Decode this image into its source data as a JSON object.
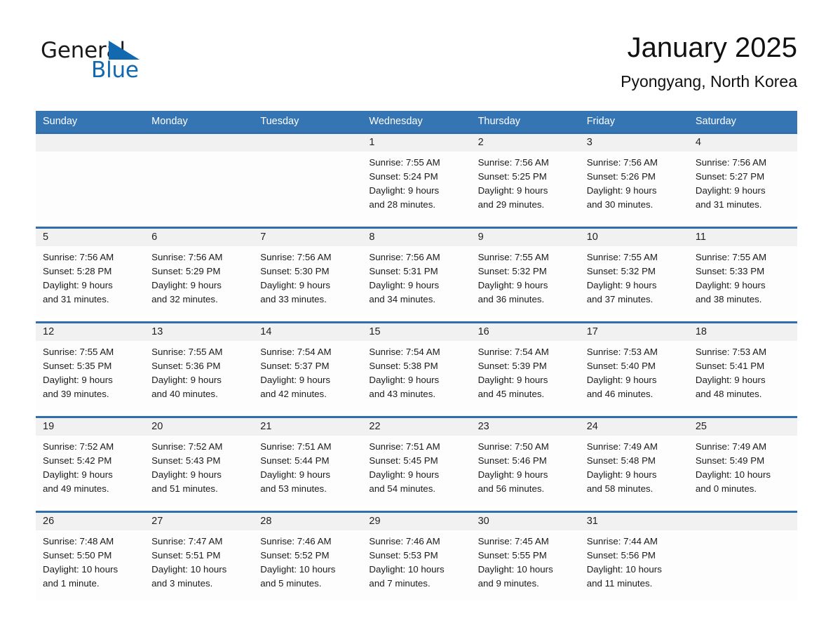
{
  "logo": {
    "word_one": "General",
    "word_two": "Blue",
    "flag_icon": "triangle-flag-icon",
    "brand_color": "#1369b0"
  },
  "header": {
    "title": "January 2025",
    "location": "Pyongyang, North Korea",
    "header_bg_color": "#3575b3",
    "row_divider_color": "#2f6fae",
    "daynum_bg_color": "#f1f1f1"
  },
  "weekdays": [
    "Sunday",
    "Monday",
    "Tuesday",
    "Wednesday",
    "Thursday",
    "Friday",
    "Saturday"
  ],
  "weeks": [
    {
      "days": [
        {
          "num": "",
          "sunrise": "",
          "sunset": "",
          "daylight_1": "",
          "daylight_2": ""
        },
        {
          "num": "",
          "sunrise": "",
          "sunset": "",
          "daylight_1": "",
          "daylight_2": ""
        },
        {
          "num": "",
          "sunrise": "",
          "sunset": "",
          "daylight_1": "",
          "daylight_2": ""
        },
        {
          "num": "1",
          "sunrise": "Sunrise: 7:55 AM",
          "sunset": "Sunset: 5:24 PM",
          "daylight_1": "Daylight: 9 hours",
          "daylight_2": "and 28 minutes."
        },
        {
          "num": "2",
          "sunrise": "Sunrise: 7:56 AM",
          "sunset": "Sunset: 5:25 PM",
          "daylight_1": "Daylight: 9 hours",
          "daylight_2": "and 29 minutes."
        },
        {
          "num": "3",
          "sunrise": "Sunrise: 7:56 AM",
          "sunset": "Sunset: 5:26 PM",
          "daylight_1": "Daylight: 9 hours",
          "daylight_2": "and 30 minutes."
        },
        {
          "num": "4",
          "sunrise": "Sunrise: 7:56 AM",
          "sunset": "Sunset: 5:27 PM",
          "daylight_1": "Daylight: 9 hours",
          "daylight_2": "and 31 minutes."
        }
      ]
    },
    {
      "days": [
        {
          "num": "5",
          "sunrise": "Sunrise: 7:56 AM",
          "sunset": "Sunset: 5:28 PM",
          "daylight_1": "Daylight: 9 hours",
          "daylight_2": "and 31 minutes."
        },
        {
          "num": "6",
          "sunrise": "Sunrise: 7:56 AM",
          "sunset": "Sunset: 5:29 PM",
          "daylight_1": "Daylight: 9 hours",
          "daylight_2": "and 32 minutes."
        },
        {
          "num": "7",
          "sunrise": "Sunrise: 7:56 AM",
          "sunset": "Sunset: 5:30 PM",
          "daylight_1": "Daylight: 9 hours",
          "daylight_2": "and 33 minutes."
        },
        {
          "num": "8",
          "sunrise": "Sunrise: 7:56 AM",
          "sunset": "Sunset: 5:31 PM",
          "daylight_1": "Daylight: 9 hours",
          "daylight_2": "and 34 minutes."
        },
        {
          "num": "9",
          "sunrise": "Sunrise: 7:55 AM",
          "sunset": "Sunset: 5:32 PM",
          "daylight_1": "Daylight: 9 hours",
          "daylight_2": "and 36 minutes."
        },
        {
          "num": "10",
          "sunrise": "Sunrise: 7:55 AM",
          "sunset": "Sunset: 5:32 PM",
          "daylight_1": "Daylight: 9 hours",
          "daylight_2": "and 37 minutes."
        },
        {
          "num": "11",
          "sunrise": "Sunrise: 7:55 AM",
          "sunset": "Sunset: 5:33 PM",
          "daylight_1": "Daylight: 9 hours",
          "daylight_2": "and 38 minutes."
        }
      ]
    },
    {
      "days": [
        {
          "num": "12",
          "sunrise": "Sunrise: 7:55 AM",
          "sunset": "Sunset: 5:35 PM",
          "daylight_1": "Daylight: 9 hours",
          "daylight_2": "and 39 minutes."
        },
        {
          "num": "13",
          "sunrise": "Sunrise: 7:55 AM",
          "sunset": "Sunset: 5:36 PM",
          "daylight_1": "Daylight: 9 hours",
          "daylight_2": "and 40 minutes."
        },
        {
          "num": "14",
          "sunrise": "Sunrise: 7:54 AM",
          "sunset": "Sunset: 5:37 PM",
          "daylight_1": "Daylight: 9 hours",
          "daylight_2": "and 42 minutes."
        },
        {
          "num": "15",
          "sunrise": "Sunrise: 7:54 AM",
          "sunset": "Sunset: 5:38 PM",
          "daylight_1": "Daylight: 9 hours",
          "daylight_2": "and 43 minutes."
        },
        {
          "num": "16",
          "sunrise": "Sunrise: 7:54 AM",
          "sunset": "Sunset: 5:39 PM",
          "daylight_1": "Daylight: 9 hours",
          "daylight_2": "and 45 minutes."
        },
        {
          "num": "17",
          "sunrise": "Sunrise: 7:53 AM",
          "sunset": "Sunset: 5:40 PM",
          "daylight_1": "Daylight: 9 hours",
          "daylight_2": "and 46 minutes."
        },
        {
          "num": "18",
          "sunrise": "Sunrise: 7:53 AM",
          "sunset": "Sunset: 5:41 PM",
          "daylight_1": "Daylight: 9 hours",
          "daylight_2": "and 48 minutes."
        }
      ]
    },
    {
      "days": [
        {
          "num": "19",
          "sunrise": "Sunrise: 7:52 AM",
          "sunset": "Sunset: 5:42 PM",
          "daylight_1": "Daylight: 9 hours",
          "daylight_2": "and 49 minutes."
        },
        {
          "num": "20",
          "sunrise": "Sunrise: 7:52 AM",
          "sunset": "Sunset: 5:43 PM",
          "daylight_1": "Daylight: 9 hours",
          "daylight_2": "and 51 minutes."
        },
        {
          "num": "21",
          "sunrise": "Sunrise: 7:51 AM",
          "sunset": "Sunset: 5:44 PM",
          "daylight_1": "Daylight: 9 hours",
          "daylight_2": "and 53 minutes."
        },
        {
          "num": "22",
          "sunrise": "Sunrise: 7:51 AM",
          "sunset": "Sunset: 5:45 PM",
          "daylight_1": "Daylight: 9 hours",
          "daylight_2": "and 54 minutes."
        },
        {
          "num": "23",
          "sunrise": "Sunrise: 7:50 AM",
          "sunset": "Sunset: 5:46 PM",
          "daylight_1": "Daylight: 9 hours",
          "daylight_2": "and 56 minutes."
        },
        {
          "num": "24",
          "sunrise": "Sunrise: 7:49 AM",
          "sunset": "Sunset: 5:48 PM",
          "daylight_1": "Daylight: 9 hours",
          "daylight_2": "and 58 minutes."
        },
        {
          "num": "25",
          "sunrise": "Sunrise: 7:49 AM",
          "sunset": "Sunset: 5:49 PM",
          "daylight_1": "Daylight: 10 hours",
          "daylight_2": "and 0 minutes."
        }
      ]
    },
    {
      "days": [
        {
          "num": "26",
          "sunrise": "Sunrise: 7:48 AM",
          "sunset": "Sunset: 5:50 PM",
          "daylight_1": "Daylight: 10 hours",
          "daylight_2": "and 1 minute."
        },
        {
          "num": "27",
          "sunrise": "Sunrise: 7:47 AM",
          "sunset": "Sunset: 5:51 PM",
          "daylight_1": "Daylight: 10 hours",
          "daylight_2": "and 3 minutes."
        },
        {
          "num": "28",
          "sunrise": "Sunrise: 7:46 AM",
          "sunset": "Sunset: 5:52 PM",
          "daylight_1": "Daylight: 10 hours",
          "daylight_2": "and 5 minutes."
        },
        {
          "num": "29",
          "sunrise": "Sunrise: 7:46 AM",
          "sunset": "Sunset: 5:53 PM",
          "daylight_1": "Daylight: 10 hours",
          "daylight_2": "and 7 minutes."
        },
        {
          "num": "30",
          "sunrise": "Sunrise: 7:45 AM",
          "sunset": "Sunset: 5:55 PM",
          "daylight_1": "Daylight: 10 hours",
          "daylight_2": "and 9 minutes."
        },
        {
          "num": "31",
          "sunrise": "Sunrise: 7:44 AM",
          "sunset": "Sunset: 5:56 PM",
          "daylight_1": "Daylight: 10 hours",
          "daylight_2": "and 11 minutes."
        },
        {
          "num": "",
          "sunrise": "",
          "sunset": "",
          "daylight_1": "",
          "daylight_2": ""
        }
      ]
    }
  ]
}
